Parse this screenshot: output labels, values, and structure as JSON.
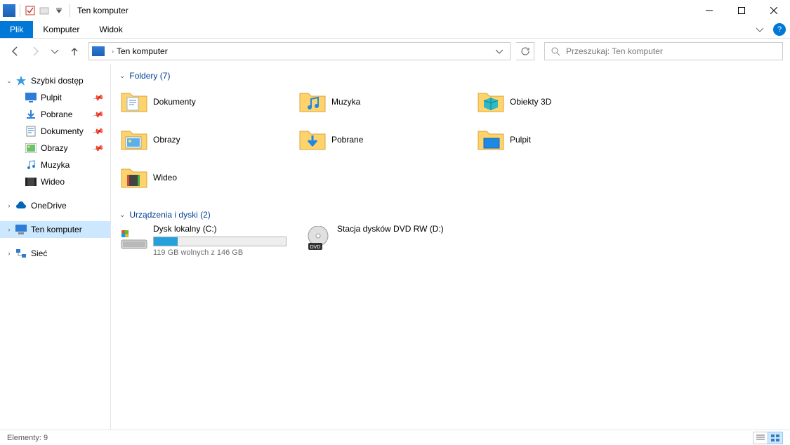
{
  "window": {
    "title": "Ten komputer"
  },
  "ribbon": {
    "file_tab": "Plik",
    "tabs": [
      "Komputer",
      "Widok"
    ]
  },
  "address": {
    "location": "Ten komputer"
  },
  "search": {
    "placeholder": "Przeszukaj: Ten komputer"
  },
  "tree": {
    "quick_access": "Szybki dostęp",
    "quick_items": [
      {
        "label": "Pulpit",
        "pinned": true,
        "icon": "desktop"
      },
      {
        "label": "Pobrane",
        "pinned": true,
        "icon": "downloads"
      },
      {
        "label": "Dokumenty",
        "pinned": true,
        "icon": "documents"
      },
      {
        "label": "Obrazy",
        "pinned": true,
        "icon": "pictures"
      },
      {
        "label": "Muzyka",
        "pinned": false,
        "icon": "music"
      },
      {
        "label": "Wideo",
        "pinned": false,
        "icon": "video"
      }
    ],
    "onedrive": "OneDrive",
    "this_pc": "Ten komputer",
    "network": "Sieć"
  },
  "groups": {
    "folders": {
      "title": "Foldery",
      "count": 7,
      "items": [
        {
          "label": "Dokumenty",
          "icon": "documents"
        },
        {
          "label": "Muzyka",
          "icon": "music"
        },
        {
          "label": "Obiekty 3D",
          "icon": "objects3d"
        },
        {
          "label": "Obrazy",
          "icon": "pictures"
        },
        {
          "label": "Pobrane",
          "icon": "downloads"
        },
        {
          "label": "Pulpit",
          "icon": "desktop"
        },
        {
          "label": "Wideo",
          "icon": "video"
        }
      ]
    },
    "devices": {
      "title": "Urządzenia i dyski",
      "count": 2,
      "items": [
        {
          "label": "Dysk lokalny (C:)",
          "sub": "119 GB wolnych z 146 GB",
          "type": "hdd"
        },
        {
          "label": "Stacja dysków DVD RW (D:)",
          "type": "dvd"
        }
      ]
    }
  },
  "status": {
    "text": "Elementy: 9"
  }
}
